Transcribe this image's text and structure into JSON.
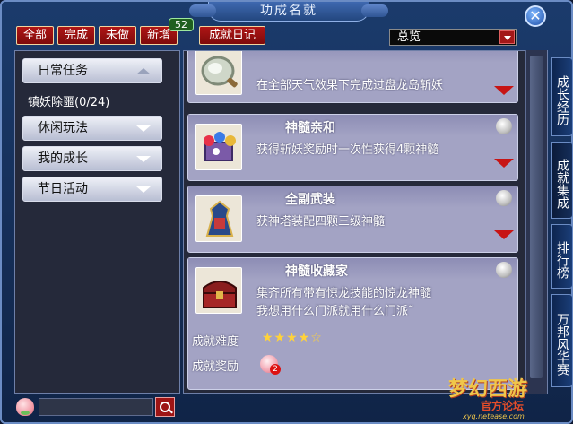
{
  "window": {
    "title": "功成名就",
    "close": "✕"
  },
  "tabs": [
    {
      "label": "全部"
    },
    {
      "label": "完成"
    },
    {
      "label": "未做"
    },
    {
      "label": "新增"
    },
    {
      "label": "成就日记"
    }
  ],
  "new_badge": "52",
  "filter": {
    "selected": "总览"
  },
  "categories": [
    {
      "label": "日常任务",
      "state": "expanded"
    },
    {
      "label": "休闲玩法",
      "state": "collapsed"
    },
    {
      "label": "我的成长",
      "state": "collapsed"
    },
    {
      "label": "节日活动",
      "state": "collapsed"
    }
  ],
  "sub_items": [
    {
      "label": "镇妖除噩(0/24)"
    }
  ],
  "achievements": [
    {
      "title": "",
      "icon": "mirror-icon",
      "desc": "在全部天气效果下完成过盘龙岛斩妖"
    },
    {
      "title": "神髓亲和",
      "icon": "gem-chest-icon",
      "desc": "获得斩妖奖励时一次性获得4颗神髓"
    },
    {
      "title": "全副武装",
      "icon": "armor-icon",
      "desc": "获神塔装配四颗三级神髓"
    },
    {
      "title": "神髓收藏家",
      "icon": "treasure-chest-icon",
      "desc_lines": [
        "集齐所有带有惊龙技能的惊龙神髓",
        "我想用什么门派就用什么门派˜"
      ],
      "difficulty_label": "成就难度",
      "difficulty_stars": "★★★★☆",
      "difficulty_value": 4,
      "reward_label": "成就奖励",
      "reward_icon": "peach-icon",
      "reward_count": "2"
    }
  ],
  "side_tabs": [
    {
      "label": "成长经历"
    },
    {
      "label": "成就集成"
    },
    {
      "label": "排行榜"
    },
    {
      "label": "万邦风华赛"
    }
  ],
  "watermark": {
    "logo": "梦幻西游",
    "sub": "官方论坛",
    "url": "xyq.netease.com"
  },
  "colors": {
    "accent_red": "#b01616",
    "frame_blue": "#1b3b6c",
    "card": "#a3a3c4",
    "star": "#ffd23a"
  }
}
